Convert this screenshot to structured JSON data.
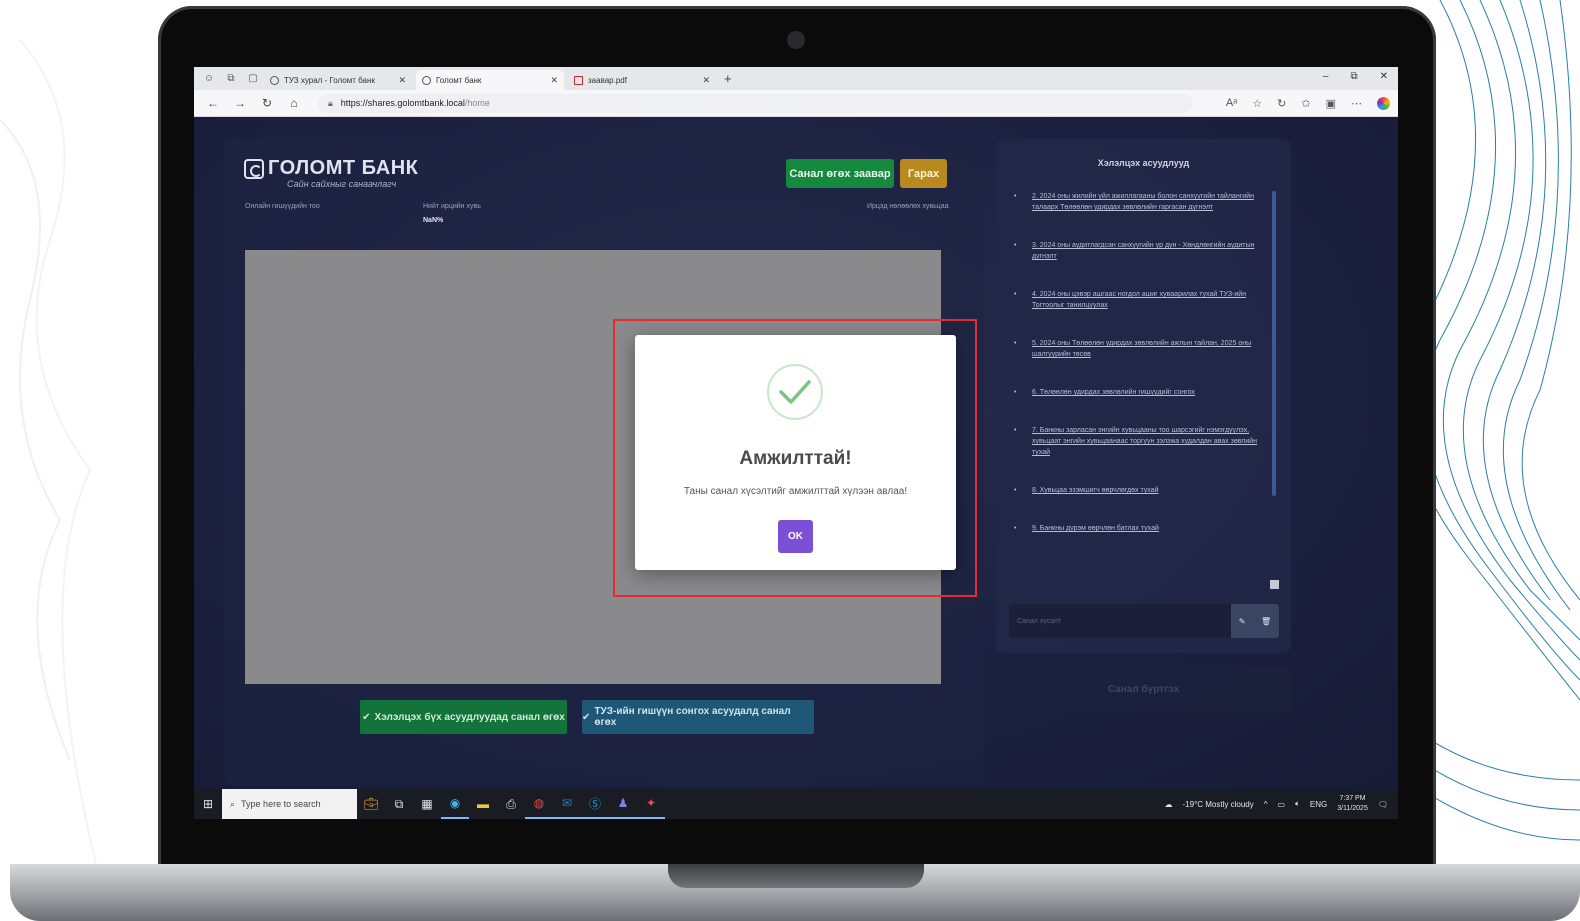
{
  "browser": {
    "tabs": [
      {
        "label": "ТУЗ хурал - Голомт банк",
        "active": false,
        "icon": "globe-icon"
      },
      {
        "label": "Голомт банк",
        "active": true,
        "icon": "globe-icon"
      },
      {
        "label": "заавар.pdf",
        "active": false,
        "icon": "pdf-icon"
      }
    ],
    "new_tab": "+",
    "url_host": "https://shares.golomtbank.local",
    "url_path": "/home"
  },
  "header": {
    "brand": "ГОЛОМТ БАНК",
    "tagline": "Сайн сайхныг санаачлагч",
    "instructions_button": "Санал өгөх заавар",
    "logout_button": "Гарах"
  },
  "stats": {
    "online_label": "Онлайн гишүүдийн тоо",
    "total_share_label": "Нийт ирцийн хувь",
    "total_share_value": "NaN%",
    "attendance_label": "Ирцэд нөлөөлөх хувьцаа"
  },
  "actions": {
    "vote_agenda": "Хэлэлцэх бүх асуудлуудад санал өгөх",
    "vote_board": "ТУЗ-ийн гишүүн сонгох асуудалд санал өгөх"
  },
  "modal": {
    "title": "Амжилттай!",
    "message": "Таны санал хүсэлтийг амжилттай хүлээн авлаа!",
    "ok": "OK"
  },
  "sidebar": {
    "title": "Хэлэлцэх асуудлууд",
    "items": [
      "2. 2024 оны жилийн үйл ажиллагааны болон санхүүгийн тайлангийн талаарх Төлөөлөн удирдах зөвлөлийн гаргасан дүгнэлт",
      "3. 2024 оны аудитлагдсан санхүүгийн үр дүн - Хөндлөнгийн аудитын дүгнэлт",
      "4. 2024 оны цэвэр ашгаас ногдол ашиг хуваарилах тухай ТУЗ-ийн Тогтоолыг танилцуулах",
      "5. 2024 оны Төлөөлөн удирдах зөвлөлийн ажлын тайлан, 2025 оны шалгуурийн төсөв",
      "6. Төлөөлөн удирдах зөвлөлийн гишүүдийг сонгох",
      "7. Банкны зарласан энгийн хувьцааны тоо шарсэгийг нэмэгдүүлэх, хувьцаат энгийн хувьцаанаас торгуун зэлэжа худалдан авах зөвлийн тухай",
      "8. Хувьцаа эзэмшигч өөрчлөгдөх тухай",
      "9. Банкны дүрэм өөрчлөн батлах тухай"
    ],
    "comment_placeholder": "Санал хүсэлт",
    "submit": "Санал бүртгэх"
  },
  "taskbar": {
    "search_placeholder": "Type here to search",
    "weather": "-19°C  Mostly cloudy",
    "lang": "ENG",
    "time": "7:37 PM",
    "date": "3/11/2025"
  }
}
